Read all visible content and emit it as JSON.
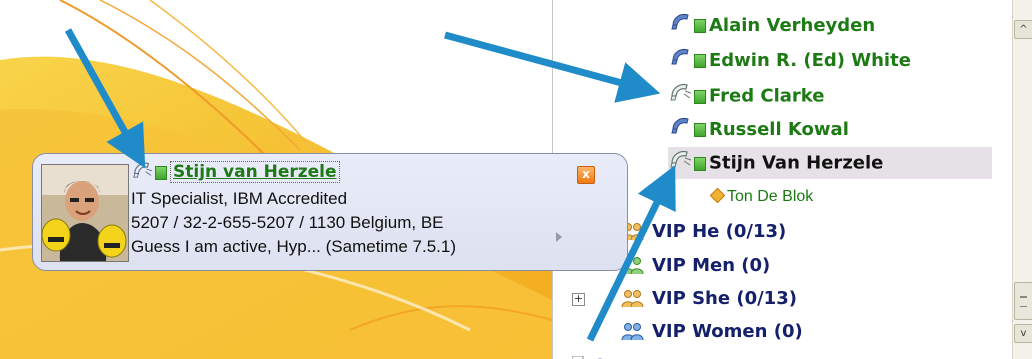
{
  "contacts": [
    {
      "name": "Alain Verheyden",
      "status": "active",
      "phone": "handset"
    },
    {
      "name": "Edwin R. (Ed) White",
      "status": "active",
      "phone": "handset"
    },
    {
      "name": "Fred Clarke",
      "status": "active",
      "phone": "handset-ringing"
    },
    {
      "name": "Russell Kowal",
      "status": "active",
      "phone": "handset"
    },
    {
      "name": "Stijn Van Herzele",
      "status": "active",
      "phone": "handset-ringing",
      "selected": true
    }
  ],
  "sub_contact": {
    "name": "Ton De Blok",
    "icon": "diamond-icon"
  },
  "groups": [
    {
      "label": "VIP He (0/13)",
      "expander": ""
    },
    {
      "label": "VIP Men (0)",
      "expander": ""
    },
    {
      "label": "VIP She (0/13)",
      "expander": "+"
    },
    {
      "label": "VIP Women (0)",
      "expander": ""
    }
  ],
  "bizcard": {
    "name": "Stijn van Herzele",
    "title": "IT Specialist, IBM Accredited",
    "phone_location": "5207 / 32-2-655-5207 / 1130 Belgium, BE",
    "status_message": "Guess I am active, Hyp... (Sametime 7.5.1)",
    "close_label": "x"
  },
  "scrollbar": {
    "up": "^",
    "down": "v"
  },
  "colors": {
    "online": "#1d7a15",
    "group": "#15206b",
    "arrow": "#1f8bc8",
    "close": "#f07a12",
    "wallpaper": "#f7c63a"
  }
}
